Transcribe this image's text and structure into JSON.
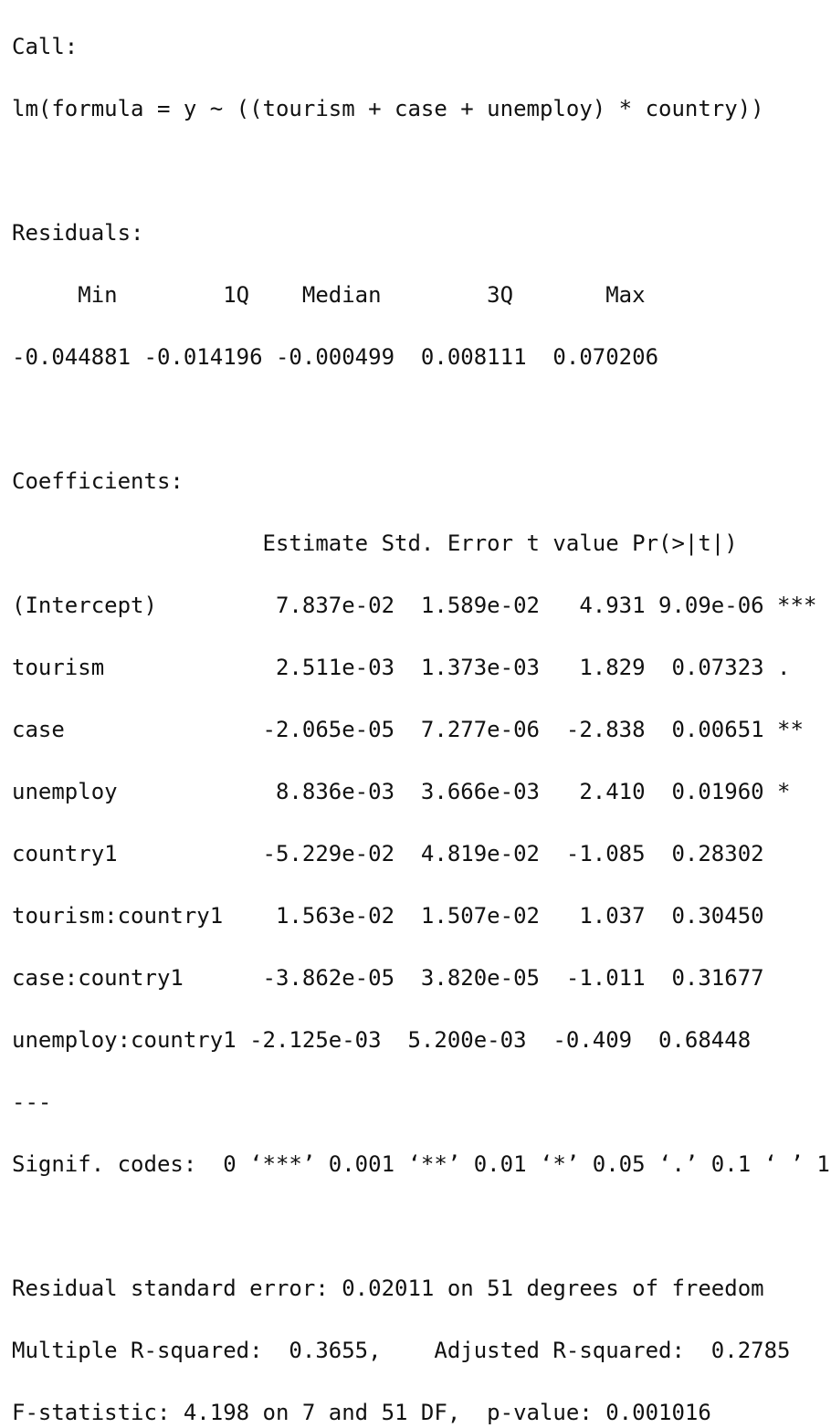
{
  "console": {
    "call_header": "Call:",
    "call_formula": "lm(formula = y ~ ((tourism + case + unemploy) * country))",
    "residuals_header": "Residuals:",
    "residuals_labels": "     Min        1Q    Median        3Q       Max ",
    "residuals_values": "-0.044881 -0.014196 -0.000499  0.008111  0.070206 ",
    "coefficients_header": "Coefficients:",
    "coef_columns": "                   Estimate Std. Error t value Pr(>|t|)    ",
    "coef_rows": [
      "(Intercept)         7.837e-02  1.589e-02   4.931 9.09e-06 ***",
      "tourism             2.511e-03  1.373e-03   1.829  0.07323 .  ",
      "case               -2.065e-05  7.277e-06  -2.838  0.00651 ** ",
      "unemploy            8.836e-03  3.666e-03   2.410  0.01960 *  ",
      "country1           -5.229e-02  4.819e-02  -1.085  0.28302    ",
      "tourism:country1    1.563e-02  1.507e-02   1.037  0.30450    ",
      "case:country1      -3.862e-05  3.820e-05  -1.011  0.31677    ",
      "unemploy:country1 -2.125e-03  5.200e-03  -0.409  0.68448    "
    ],
    "separator": "---",
    "signif_codes": "Signif. codes:  0 ‘***’ 0.001 ‘**’ 0.01 ‘*’ 0.05 ‘.’ 0.1 ‘ ’ 1",
    "residual_se": "Residual standard error: 0.02011 on 51 degrees of freedom",
    "r_squared": "Multiple R-squared:  0.3655,\tAdjusted R-squared:  0.2785 ",
    "f_statistic": "F-statistic: 4.198 on 7 and 51 DF,  p-value: 0.001016"
  }
}
